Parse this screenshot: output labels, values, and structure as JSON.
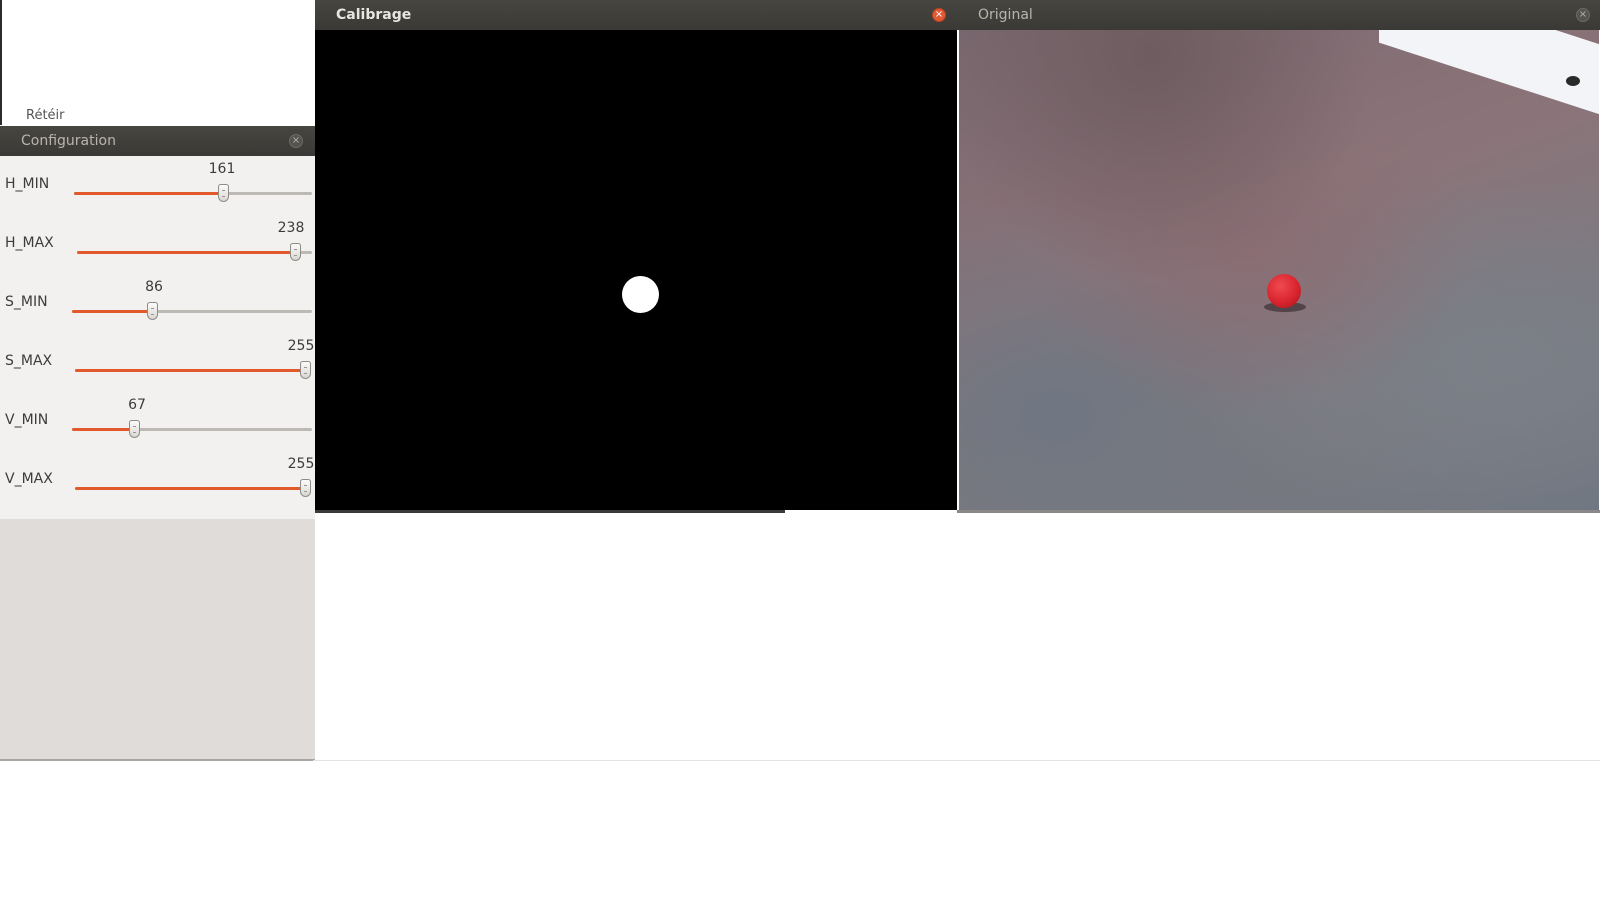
{
  "background_window": {
    "partial_text": "Rétéir"
  },
  "configuration": {
    "title": "Configuration",
    "close_symbol": "×",
    "sliders": [
      {
        "label": "H_MIN",
        "value": "161",
        "fraction": 0.631
      },
      {
        "label": "H_MAX",
        "value": "238",
        "fraction": 0.933
      },
      {
        "label": "S_MIN",
        "value": "86",
        "fraction": 0.337
      },
      {
        "label": "S_MAX",
        "value": "255",
        "fraction": 1.0
      },
      {
        "label": "V_MIN",
        "value": "67",
        "fraction": 0.263
      },
      {
        "label": "V_MAX",
        "value": "255",
        "fraction": 1.0
      }
    ]
  },
  "calibrage": {
    "title": "Calibrage",
    "close_symbol": "×"
  },
  "original": {
    "title": "Original",
    "close_symbol": "×"
  },
  "colors": {
    "accent": "#e25a2c",
    "titlebar": "#3c3b37",
    "panel": "#f2f1f0"
  }
}
